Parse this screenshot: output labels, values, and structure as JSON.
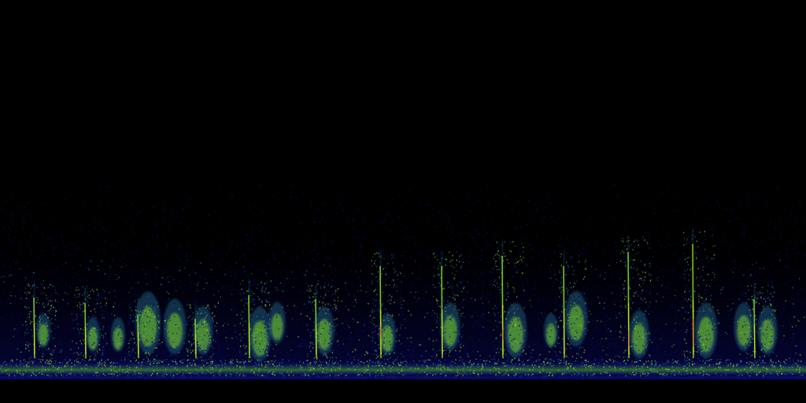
{
  "spectrogram": {
    "colormap": {
      "background": "#000000",
      "low": "#0a0a6e",
      "mid": "#1e6b8a",
      "high": "#7ed321",
      "peak": "#d4e600",
      "hot": "#ff5a1f"
    }
  }
}
